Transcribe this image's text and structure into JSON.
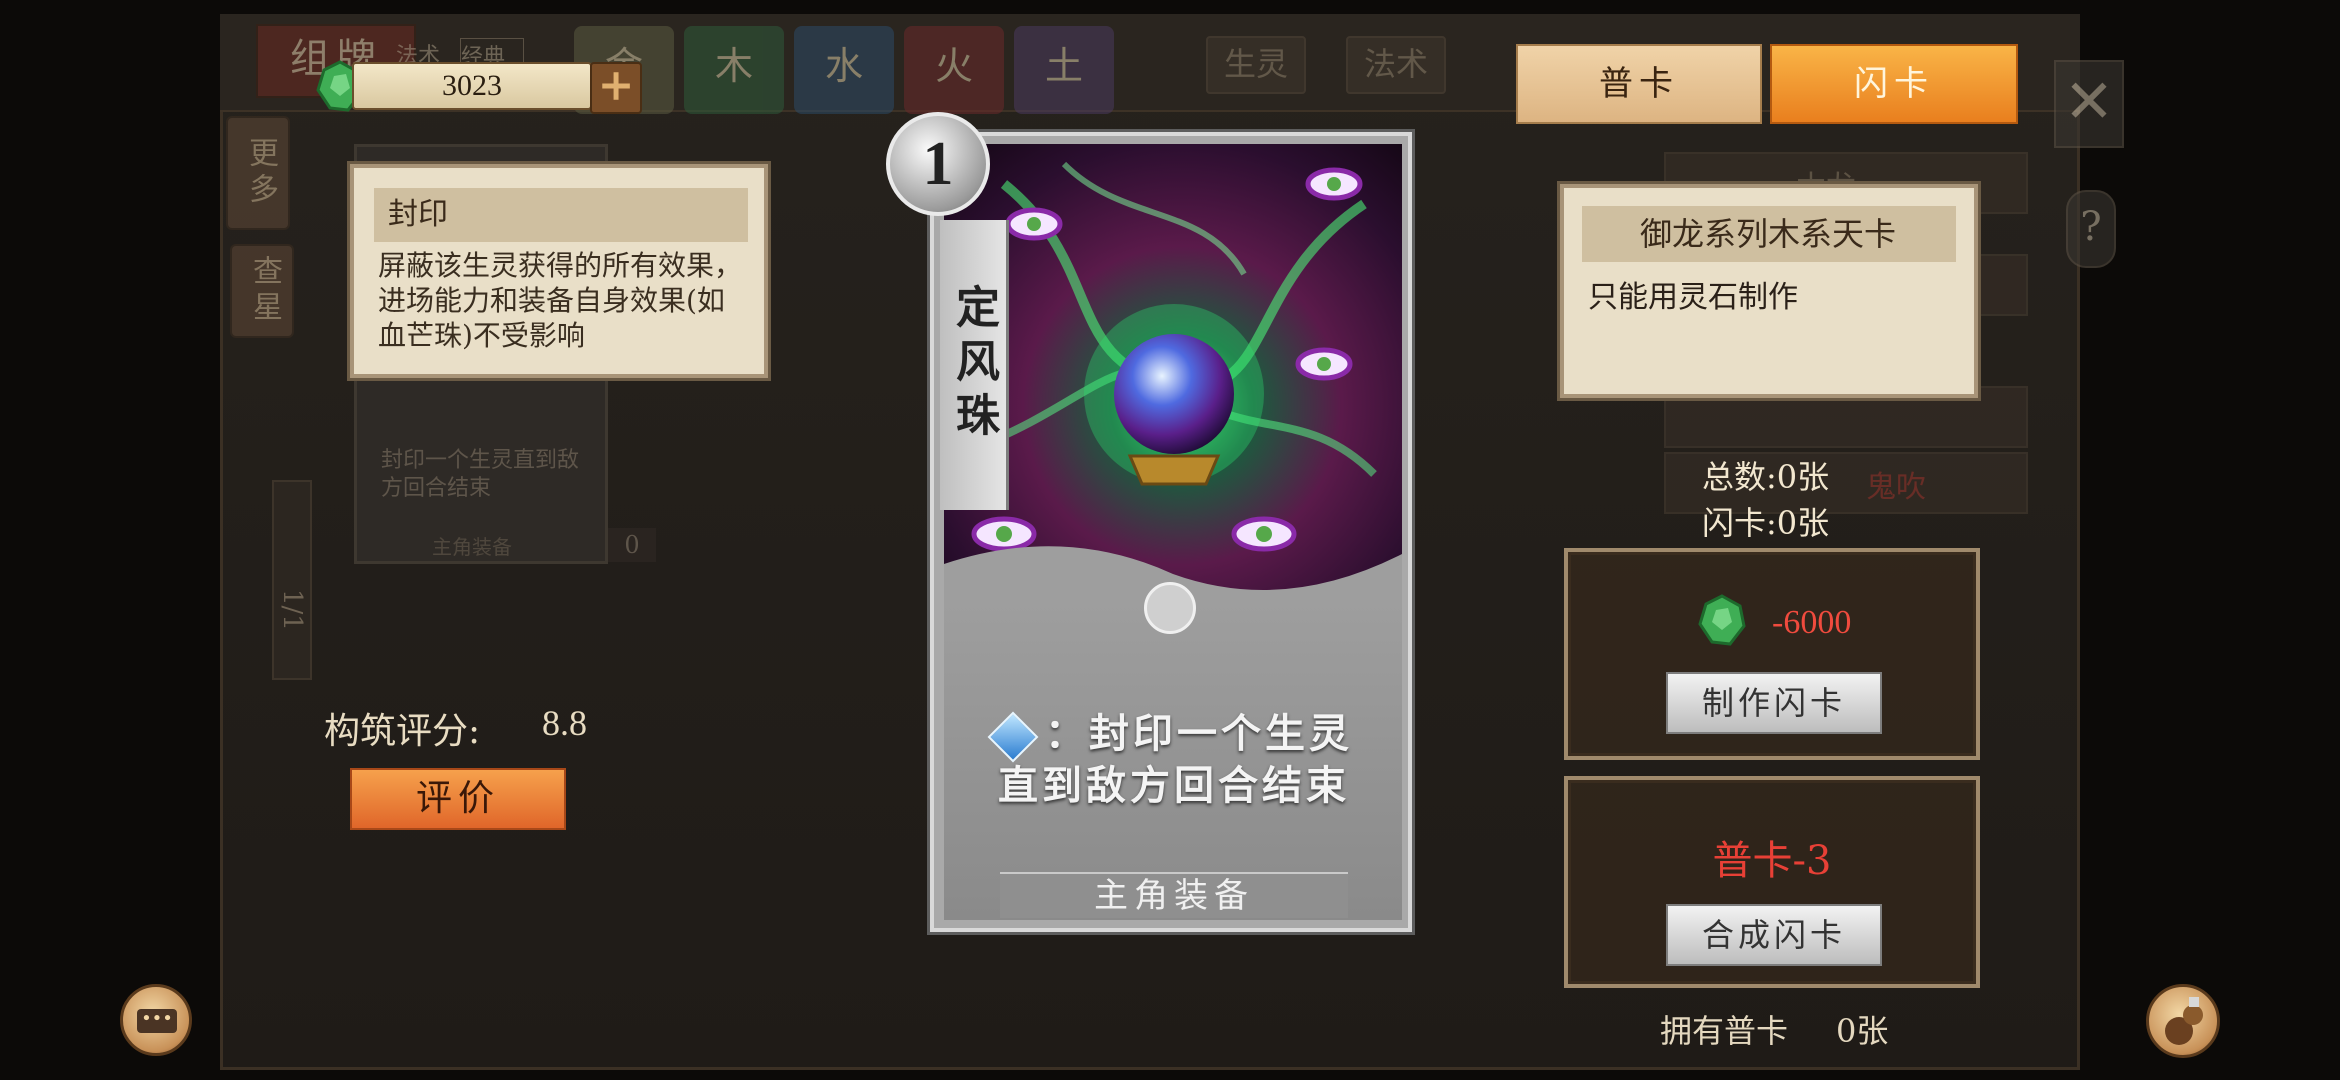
{
  "top": {
    "deck_title": "组牌",
    "deck_sub_tabs": [
      "法术",
      "经典"
    ],
    "element_tabs": [
      "金",
      "木",
      "水",
      "火",
      "土"
    ],
    "category_tabs": [
      "生灵",
      "法术"
    ],
    "currency_value": "3023",
    "currency_plus": "+"
  },
  "left_sidebar": {
    "more_label": "更多",
    "view_label": "查星",
    "page_indicator": "1/1"
  },
  "bg_card": {
    "effect": "封印一个生灵直到敌方回合结束",
    "type": "主角装备",
    "count": "0"
  },
  "keyword_tooltip": {
    "title": "封印",
    "body": "屏蔽该生灵获得的所有效果，进场能力和装备自身效果(如血芒珠)不受影响"
  },
  "score": {
    "label": "构筑评分:",
    "value": "8.8",
    "rate_button": "评价"
  },
  "card": {
    "cost": "1",
    "name": "定风珠",
    "cost_icon_value": "1",
    "effect_line1": "：封印一个生灵",
    "effect_line2": "直到敌方回合结束",
    "type": "主角装备"
  },
  "tabs": {
    "normal": "普卡",
    "flash": "闪卡",
    "active": "flash"
  },
  "controls": {
    "close": "✕",
    "help": "?"
  },
  "series_tooltip": {
    "title": "御龙系列木系天卡",
    "body": "只能用灵石制作"
  },
  "right_list_hint": {
    "item1": "木龙",
    "item2": "鬼吹"
  },
  "stats": {
    "total": "总数:0张",
    "flash": "闪卡:0张"
  },
  "craft": {
    "cost": "-6000",
    "button": "制作闪卡"
  },
  "synth": {
    "requirement": "普卡-3",
    "button": "合成闪卡"
  },
  "owned": {
    "label": "拥有普卡",
    "value": "0张"
  },
  "colors": {
    "accent_orange": "#e97f1e",
    "cost_red": "#f04b3e",
    "parchment": "#e9dfc8"
  },
  "icons": {
    "currency": "spirit-stone-icon",
    "chat": "chat-icon",
    "tool": "gourd-tool-icon",
    "series": "fire-icon"
  }
}
